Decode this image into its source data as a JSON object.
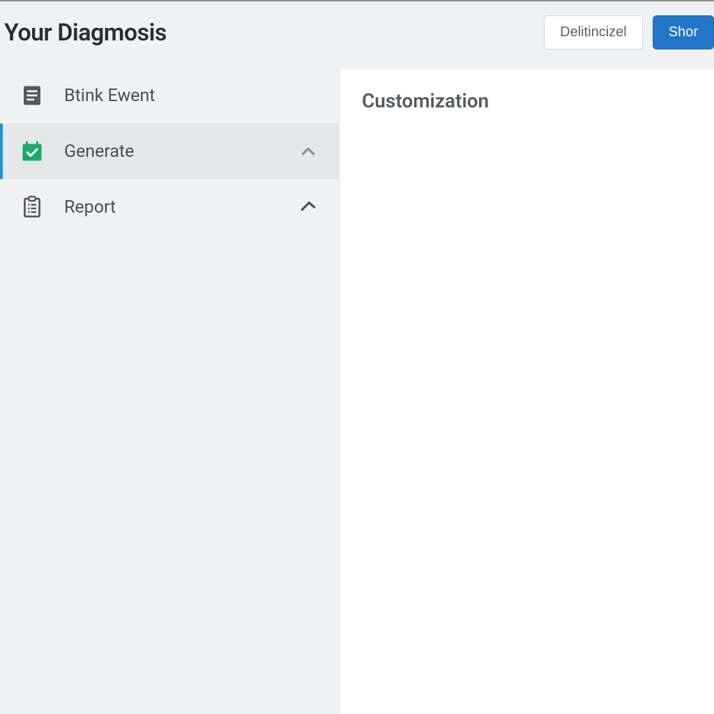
{
  "header": {
    "title": "Your Diagmosis",
    "buttons": {
      "secondary": "Delitincizel",
      "primary": "Shor"
    }
  },
  "sidebar": {
    "items": [
      {
        "label": "Btink Ewent"
      },
      {
        "label": "Generate"
      },
      {
        "label": "Report"
      }
    ]
  },
  "main": {
    "title": "Customization"
  }
}
